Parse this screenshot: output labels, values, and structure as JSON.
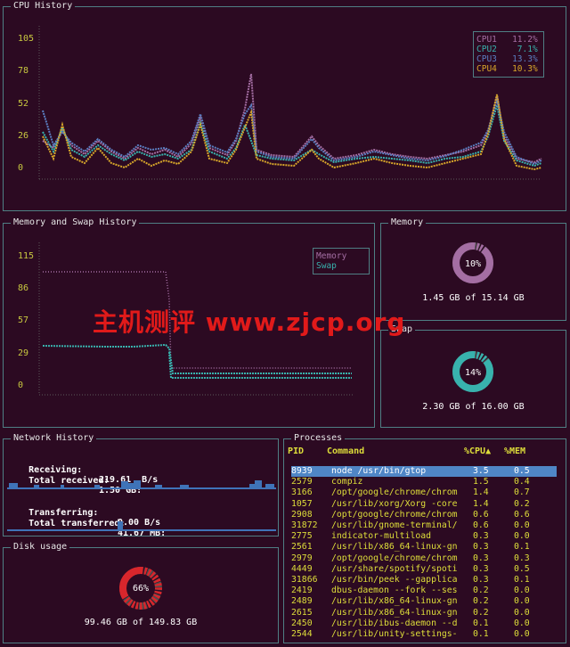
{
  "cpu_history": {
    "title": "CPU History",
    "yticks": [
      "105",
      "78",
      "52",
      "26",
      "0"
    ],
    "legend": [
      {
        "name": "CPU1",
        "value": "11.2%",
        "color": "#a46ea3"
      },
      {
        "name": "CPU2",
        "value": "7.1%",
        "color": "#38b2ad"
      },
      {
        "name": "CPU3",
        "value": "13.3%",
        "color": "#5b7fc2"
      },
      {
        "name": "CPU4",
        "value": "10.3%",
        "color": "#d8a72a"
      }
    ]
  },
  "memory_history": {
    "title": "Memory and Swap History",
    "yticks": [
      "115",
      "86",
      "57",
      "29",
      "0"
    ],
    "legend": [
      {
        "name": "Memory",
        "color": "#a46ea3"
      },
      {
        "name": "Swap",
        "color": "#38b2ad"
      }
    ]
  },
  "memory": {
    "title": "Memory",
    "percent_label": "10%",
    "percent": 10,
    "detail": "1.45 GB of 15.14 GB",
    "color": "#a46ea3"
  },
  "swap": {
    "title": "Swap",
    "percent_label": "14%",
    "percent": 14,
    "detail": "2.30 GB of 16.00 GB",
    "color": "#38b2ad"
  },
  "network": {
    "title": "Network History",
    "receiving_label": "Receiving:",
    "receiving_value": "219.61  B/s",
    "total_received_label": "Total received:",
    "total_received_value": "1.50 GB:",
    "transferring_label": "Transferring:",
    "transferring_value": "0.00 B/s",
    "total_transferred_label": "Total transferred:",
    "total_transferred_value": "41.67 MB:"
  },
  "disk": {
    "title": "Disk usage",
    "percent_label": "66%",
    "percent": 66,
    "detail": "99.46 GB of 149.83 GB",
    "color": "#d8262c"
  },
  "processes": {
    "title": "Processes",
    "headers": {
      "pid": "PID",
      "command": "Command",
      "cpu": "%CPU▲",
      "mem": "%MEM"
    },
    "rows": [
      {
        "pid": "8939",
        "command": "node /usr/bin/gtop",
        "cpu": "3.5",
        "mem": "0.5"
      },
      {
        "pid": "2579",
        "command": "compiz",
        "cpu": "1.5",
        "mem": "0.4"
      },
      {
        "pid": "3166",
        "command": "/opt/google/chrome/chrom",
        "cpu": "1.4",
        "mem": "0.7"
      },
      {
        "pid": "1057",
        "command": "/usr/lib/xorg/Xorg -core",
        "cpu": "1.4",
        "mem": "0.2"
      },
      {
        "pid": "2908",
        "command": "/opt/google/chrome/chrom",
        "cpu": "0.6",
        "mem": "0.6"
      },
      {
        "pid": "31872",
        "command": "/usr/lib/gnome-terminal/",
        "cpu": "0.6",
        "mem": "0.0"
      },
      {
        "pid": "2775",
        "command": "indicator-multiload",
        "cpu": "0.3",
        "mem": "0.0"
      },
      {
        "pid": "2561",
        "command": "/usr/lib/x86_64-linux-gn",
        "cpu": "0.3",
        "mem": "0.1"
      },
      {
        "pid": "2979",
        "command": "/opt/google/chrome/chrom",
        "cpu": "0.3",
        "mem": "0.3"
      },
      {
        "pid": "4449",
        "command": "/usr/share/spotify/spoti",
        "cpu": "0.3",
        "mem": "0.5"
      },
      {
        "pid": "31866",
        "command": "/usr/bin/peek --gapplica",
        "cpu": "0.3",
        "mem": "0.1"
      },
      {
        "pid": "2419",
        "command": "dbus-daemon --fork --ses",
        "cpu": "0.2",
        "mem": "0.0"
      },
      {
        "pid": "2489",
        "command": "/usr/lib/x86_64-linux-gn",
        "cpu": "0.2",
        "mem": "0.0"
      },
      {
        "pid": "2615",
        "command": "/usr/lib/x86_64-linux-gn",
        "cpu": "0.2",
        "mem": "0.0"
      },
      {
        "pid": "2450",
        "command": "/usr/lib/ibus-daemon --d",
        "cpu": "0.1",
        "mem": "0.0"
      },
      {
        "pid": "2544",
        "command": "/usr/lib/unity-settings-",
        "cpu": "0.1",
        "mem": "0.0"
      }
    ]
  },
  "watermark": "主机测评 www.zjcp.org"
}
